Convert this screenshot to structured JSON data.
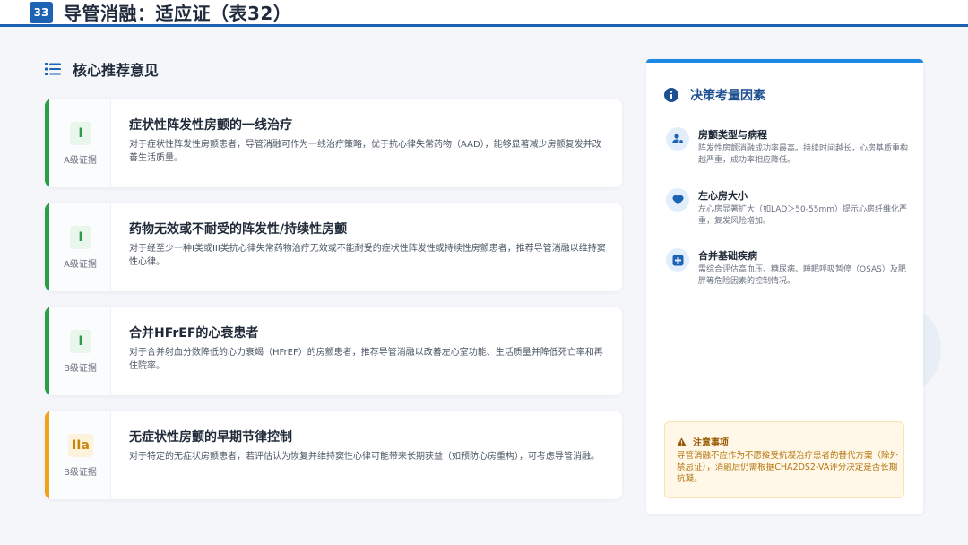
{
  "header": {
    "page_number": "33",
    "title": "导管消融：适应证（表32）"
  },
  "section": {
    "title": "核心推荐意见"
  },
  "recommendations": [
    {
      "level": "I",
      "evidence": "A级证据",
      "title": "症状性阵发性房颤的一线治疗",
      "desc": "对于症状性阵发性房颤患者，导管消融可作为一线治疗策略，优于抗心律失常药物（AAD），能够显著减少房颤复发并改善生活质量。",
      "color": "#2e9b47"
    },
    {
      "level": "I",
      "evidence": "A级证据",
      "title": "药物无效或不耐受的阵发性/持续性房颤",
      "desc": "对于经至少一种I类或III类抗心律失常药物治疗无效或不能耐受的症状性阵发性或持续性房颤患者，推荐导管消融以维持窦性心律。",
      "color": "#2e9b47"
    },
    {
      "level": "I",
      "evidence": "B级证据",
      "title": "合并HFrEF的心衰患者",
      "desc": "对于合并射血分数降低的心力衰竭（HFrEF）的房颤患者，推荐导管消融以改善左心室功能、生活质量并降低死亡率和再住院率。",
      "color": "#2e9b47"
    },
    {
      "level": "IIa",
      "evidence": "B级证据",
      "title": "无症状性房颤的早期节律控制",
      "desc": "对于特定的无症状房颤患者，若评估认为恢复并维持窦性心律可能带来长期获益（如预防心房重构），可考虑导管消融。",
      "color": "#f0a21b"
    }
  ],
  "side": {
    "title": "决策考量因素",
    "factors": [
      {
        "icon": "user-icon",
        "title": "房颤类型与病程",
        "desc": "阵发性房颤消融成功率最高。持续时间越长，心房基质重构越严重，成功率相应降低。"
      },
      {
        "icon": "heart-icon",
        "title": "左心房大小",
        "desc": "左心房显著扩大（如LAD＞50-55mm）提示心房纤维化严重，复发风险增加。"
      },
      {
        "icon": "medical-plus-icon",
        "title": "合并基础疾病",
        "desc": "需综合评估高血压、糖尿病、睡眠呼吸暂停（OSAS）及肥胖等危险因素的控制情况。"
      }
    ],
    "caution": {
      "title": "注意事项",
      "text": "导管消融不应作为不愿接受抗凝治疗患者的替代方案（除外禁忌证），消融后仍需根据CHA2DS2-VA评分决定是否长期抗凝。"
    }
  },
  "colors": {
    "brand": "#1d63b4",
    "accent": "#1e88e5",
    "class_i": "#2e9b47",
    "class_iia": "#f0a21b"
  }
}
